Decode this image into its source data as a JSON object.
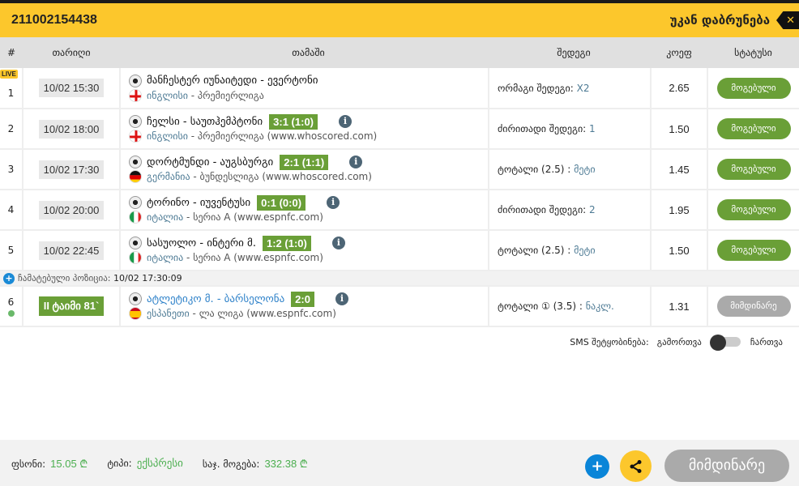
{
  "header": {
    "ticket_id": "211002154438",
    "back_label": "უკან დაბრუნება"
  },
  "columns": {
    "num": "#",
    "date": "თარიღი",
    "game": "თამაში",
    "result": "შედეგი",
    "coef": "კოეფ",
    "status": "სტატუსი"
  },
  "live_badge": "LIVE",
  "rows": [
    {
      "num": "1",
      "date": "10/02 15:30",
      "teams": "მანჩესტერ იუნაიტედი - ევერტონი",
      "score": "",
      "country": "ინგლისი",
      "league": " - პრემიერლიგა",
      "source": "",
      "pick_label": "ორმაგი შედეგი: ",
      "pick_value": "X2",
      "coef": "2.65",
      "status": "მოგებული",
      "flag": "england"
    },
    {
      "num": "2",
      "date": "10/02 18:00",
      "teams": "ჩელსი - საუთჰემპტონი",
      "score": "3:1 (1:0)",
      "country": "ინგლისი",
      "league": " - პრემიერლიგა",
      "source": " (www.whoscored.com)",
      "pick_label": "ძირითადი შედეგი: ",
      "pick_value": "1",
      "coef": "1.50",
      "status": "მოგებული",
      "flag": "england"
    },
    {
      "num": "3",
      "date": "10/02 17:30",
      "teams": "დორტმუნდი - აუგსბურგი",
      "score": "2:1 (1:1)",
      "country": "გერმანია",
      "league": " - ბუნდესლიგა",
      "source": " (www.whoscored.com)",
      "pick_label": "ტოტალი (2.5) : ",
      "pick_value": "მეტი",
      "coef": "1.45",
      "status": "მოგებული",
      "flag": "germany"
    },
    {
      "num": "4",
      "date": "10/02 20:00",
      "teams": "ტორინო - იუვენტუსი",
      "score": "0:1 (0:0)",
      "country": "იტალია",
      "league": " - სერია A",
      "source": " (www.espnfc.com)",
      "pick_label": "ძირითადი შედეგი: ",
      "pick_value": "2",
      "coef": "1.95",
      "status": "მოგებული",
      "flag": "italy"
    },
    {
      "num": "5",
      "date": "10/02 22:45",
      "teams": "სასუოლო - ინტერი მ.",
      "score": "1:2 (1:0)",
      "country": "იტალია",
      "league": " - სერია A",
      "source": " (www.espnfc.com)",
      "pick_label": "ტოტალი (2.5) : ",
      "pick_value": "მეტი",
      "coef": "1.50",
      "status": "მოგებული",
      "flag": "italy"
    }
  ],
  "added": {
    "label": "ჩამატებული პოზიცია: ",
    "time": "10/02 17:30:09"
  },
  "live_row": {
    "num": "6",
    "timer": "II ტაიმი 81`",
    "teams": "ატლეტიკო მ. - ბარსელონა",
    "score": "2:0",
    "country": "ესპანეთი",
    "league": " - ლა ლიგა",
    "source": " (www.espnfc.com)",
    "pick_label": "ტოტალი ① (3.5) : ",
    "pick_value": "ნაკლ.",
    "coef": "1.31",
    "status": "მიმდინარე",
    "flag": "spain"
  },
  "sms": {
    "label": "SMS შეტყობინება:",
    "off": "გამორთვა",
    "on": "ჩართვა"
  },
  "footer": {
    "stake_label": "ფსონი:",
    "stake": "15.05 ₾",
    "type_label": "ტიპი:",
    "type": "ექსპრესი",
    "win_label": "საჯ. მოგება:",
    "win": "332.38 ₾",
    "status_button": "მიმდინარე",
    "plus": "+"
  }
}
